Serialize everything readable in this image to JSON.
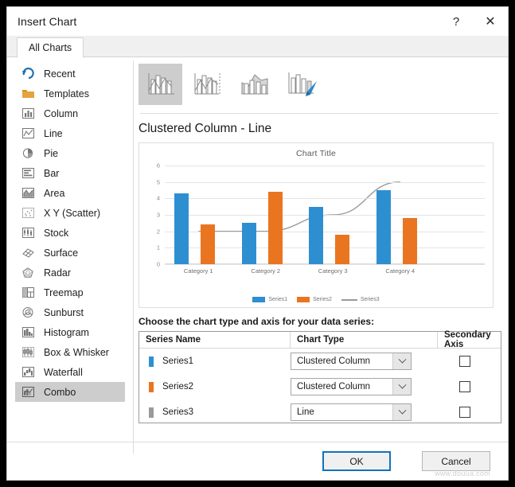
{
  "window": {
    "title": "Insert Chart",
    "help_button": "?",
    "close_button": "✕"
  },
  "tabs": [
    {
      "label": "All Charts",
      "active": true
    }
  ],
  "sidebar": {
    "items": [
      {
        "label": "Recent",
        "icon": "recent-icon",
        "selected": false
      },
      {
        "label": "Templates",
        "icon": "folder-icon",
        "selected": false
      },
      {
        "label": "Column",
        "icon": "column-icon",
        "selected": false
      },
      {
        "label": "Line",
        "icon": "line-icon",
        "selected": false
      },
      {
        "label": "Pie",
        "icon": "pie-icon",
        "selected": false
      },
      {
        "label": "Bar",
        "icon": "bar-icon",
        "selected": false
      },
      {
        "label": "Area",
        "icon": "area-icon",
        "selected": false
      },
      {
        "label": "X Y (Scatter)",
        "icon": "scatter-icon",
        "selected": false
      },
      {
        "label": "Stock",
        "icon": "stock-icon",
        "selected": false
      },
      {
        "label": "Surface",
        "icon": "surface-icon",
        "selected": false
      },
      {
        "label": "Radar",
        "icon": "radar-icon",
        "selected": false
      },
      {
        "label": "Treemap",
        "icon": "treemap-icon",
        "selected": false
      },
      {
        "label": "Sunburst",
        "icon": "sunburst-icon",
        "selected": false
      },
      {
        "label": "Histogram",
        "icon": "histogram-icon",
        "selected": false
      },
      {
        "label": "Box & Whisker",
        "icon": "box-whisker-icon",
        "selected": false
      },
      {
        "label": "Waterfall",
        "icon": "waterfall-icon",
        "selected": false
      },
      {
        "label": "Combo",
        "icon": "combo-icon",
        "selected": true
      }
    ]
  },
  "thumbnails": [
    {
      "name": "clustered-column-line",
      "selected": true
    },
    {
      "name": "clustered-column-line-secondary-axis",
      "selected": false
    },
    {
      "name": "stacked-area-clustered-column",
      "selected": false
    },
    {
      "name": "custom-combination",
      "selected": false
    }
  ],
  "preview": {
    "heading": "Clustered Column - Line"
  },
  "chart_data": {
    "type": "bar",
    "title": "Chart Title",
    "xlabel": "",
    "ylabel": "",
    "ylim": [
      0,
      6
    ],
    "yticks": [
      6,
      5,
      4,
      3,
      2,
      1,
      0
    ],
    "grid": true,
    "legend_position": "bottom",
    "categories": [
      "Category 1",
      "Category 2",
      "Category 3",
      "Category 4"
    ],
    "series": [
      {
        "name": "Series1",
        "type": "clustered-column",
        "color": "#2E8FD0",
        "values": [
          4.3,
          2.5,
          3.5,
          4.5
        ]
      },
      {
        "name": "Series2",
        "type": "clustered-column",
        "color": "#EA7521",
        "values": [
          2.4,
          4.4,
          1.8,
          2.8
        ]
      },
      {
        "name": "Series3",
        "type": "line",
        "color": "#9A9A9A",
        "values": [
          2.0,
          2.0,
          3.0,
          5.0
        ]
      }
    ]
  },
  "series_table": {
    "instruction": "Choose the chart type and axis for your data series:",
    "headers": {
      "series_name": "Series Name",
      "chart_type": "Chart Type",
      "secondary_axis": "Secondary Axis"
    },
    "rows": [
      {
        "name": "Series1",
        "swatch": "#2E8FD0",
        "chart_type": "Clustered Column",
        "secondary_axis": false
      },
      {
        "name": "Series2",
        "swatch": "#EA7521",
        "chart_type": "Clustered Column",
        "secondary_axis": false
      },
      {
        "name": "Series3",
        "swatch": "#9A9A9A",
        "chart_type": "Line",
        "secondary_axis": false
      }
    ]
  },
  "footer": {
    "ok_label": "OK",
    "cancel_label": "Cancel"
  },
  "watermark": "www.douua.com"
}
